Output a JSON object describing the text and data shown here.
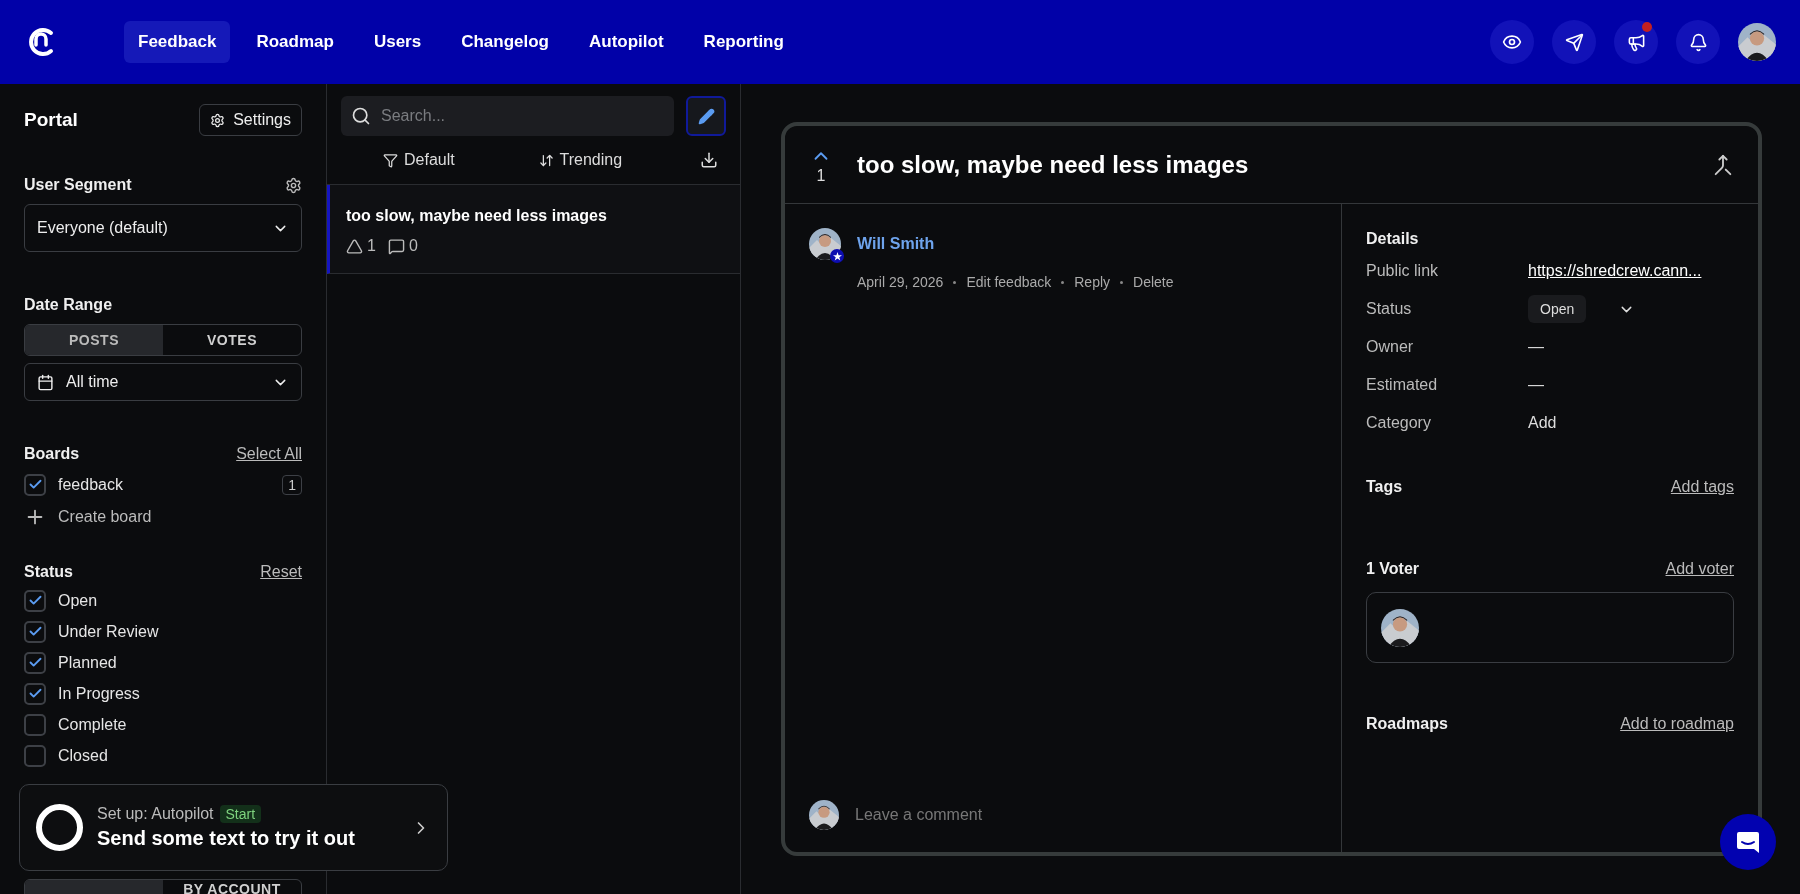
{
  "nav": {
    "items": [
      {
        "label": "Feedback",
        "selected": true
      },
      {
        "label": "Roadmap",
        "selected": false
      },
      {
        "label": "Users",
        "selected": false
      },
      {
        "label": "Changelog",
        "selected": false
      },
      {
        "label": "Autopilot",
        "selected": false
      },
      {
        "label": "Reporting",
        "selected": false
      }
    ],
    "actions": [
      {
        "kind": "eye",
        "badge": false
      },
      {
        "kind": "send",
        "badge": false
      },
      {
        "kind": "megaphone",
        "badge": true
      },
      {
        "kind": "bell",
        "badge": false
      }
    ]
  },
  "sidebar": {
    "title": "Portal",
    "settings_button": "Settings",
    "user_segment": {
      "label": "User Segment",
      "value": "Everyone (default)"
    },
    "date_range": {
      "label": "Date Range",
      "tabs": [
        {
          "label": "POSTS",
          "selected": true
        },
        {
          "label": "VOTES",
          "selected": false
        }
      ],
      "value": "All time"
    },
    "boards": {
      "label": "Boards",
      "action": "Select All",
      "items": [
        {
          "name": "feedback",
          "checked": true,
          "count": "1"
        }
      ],
      "create": "Create board"
    },
    "status": {
      "label": "Status",
      "action": "Reset",
      "items": [
        {
          "name": "Open",
          "checked": true
        },
        {
          "name": "Under Review",
          "checked": true
        },
        {
          "name": "Planned",
          "checked": true
        },
        {
          "name": "In Progress",
          "checked": true
        },
        {
          "name": "Complete",
          "checked": false
        },
        {
          "name": "Closed",
          "checked": false
        }
      ]
    },
    "bottom_tabs": [
      {
        "selected": true
      },
      {
        "label": "BY ACCOUNT",
        "selected": false
      }
    ]
  },
  "setup_card": {
    "title": "Set up: Autopilot",
    "badge": "Start",
    "text": "Send some text to try it out"
  },
  "list": {
    "search_placeholder": "Search...",
    "filter": "Default",
    "sort": "Trending",
    "posts": [
      {
        "title": "too slow, maybe need less images",
        "votes": "1",
        "comments": "0",
        "selected": true
      }
    ]
  },
  "post": {
    "votes": "1",
    "title": "too slow, maybe need less images",
    "author": "Will Smith",
    "date": "April 29, 2026",
    "actions": [
      "Edit feedback",
      "Reply",
      "Delete"
    ],
    "comment_placeholder": "Leave a comment",
    "details": {
      "title": "Details",
      "rows": [
        {
          "label": "Public link",
          "value": "https://shredcrew.cann...",
          "kind": "link"
        },
        {
          "label": "Status",
          "value": "Open",
          "kind": "select"
        },
        {
          "label": "Owner",
          "value": "—",
          "kind": "text"
        },
        {
          "label": "Estimated",
          "value": "—",
          "kind": "text"
        },
        {
          "label": "Category",
          "value": "Add",
          "kind": "text"
        }
      ]
    },
    "tags": {
      "title": "Tags",
      "action": "Add tags"
    },
    "voters": {
      "title": "1 Voter",
      "action": "Add voter"
    },
    "roadmaps": {
      "title": "Roadmaps",
      "action": "Add to roadmap"
    }
  }
}
